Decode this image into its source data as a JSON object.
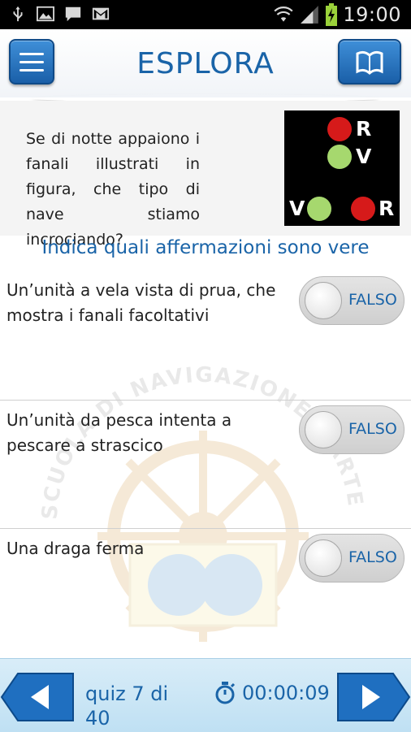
{
  "status_bar": {
    "time": "19:00",
    "icons": [
      "usb-icon",
      "gallery-icon",
      "message-icon",
      "gmail-icon",
      "wifi-icon",
      "signal-icon",
      "battery-charging-icon"
    ]
  },
  "header": {
    "title": "ESPLORA",
    "menu_icon": "hamburger-menu-icon",
    "book_icon": "open-book-icon"
  },
  "question": {
    "text": "Se di notte appaiono i fanali illustrati in figura, che tipo di nave stiamo incrociando?",
    "image": {
      "lights": [
        {
          "color": "red",
          "label": "R"
        },
        {
          "color": "green",
          "label": "V"
        },
        {
          "color": "green",
          "label": "V"
        },
        {
          "color": "red",
          "label": "R"
        }
      ]
    }
  },
  "instructions": "Indica quali affermazioni sono vere",
  "statements": [
    {
      "text": "Un’unità a vela vista di prua, che mostra i fanali facoltativi",
      "toggle_label": "FALSO",
      "value": false
    },
    {
      "text": "Un’unità da pesca intenta a pescare a strascico",
      "toggle_label": "FALSO",
      "value": false
    },
    {
      "text": "Una draga ferma",
      "toggle_label": "FALSO",
      "value": false
    }
  ],
  "watermark": {
    "text": "SCUOLA DI NAVIGAZIONE E ARTE MARINARESCA"
  },
  "footer": {
    "quiz_label": "quiz 7 di 40",
    "timer": "00:00:09",
    "prev_icon": "arrow-left-icon",
    "next_icon": "arrow-right-icon",
    "timer_icon": "stopwatch-icon"
  },
  "colors": {
    "accent_blue": "#1a64a8",
    "button_blue": "#2b7bc8",
    "footer_bg": "#cde7f6"
  }
}
